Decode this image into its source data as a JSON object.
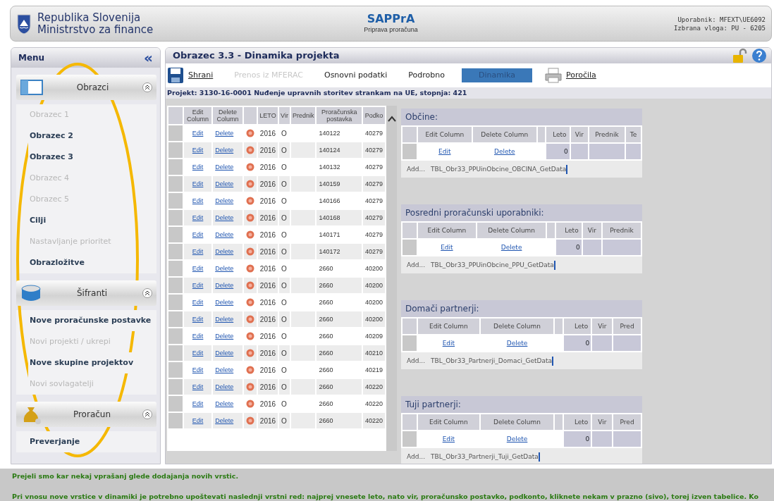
{
  "header": {
    "org_line1": "Republika Slovenija",
    "org_line2": "Ministrstvo za finance",
    "app_title": "SAPPrA",
    "app_subtitle": "Priprava proračuna",
    "user": "Uporabnik: MFEXT\\UE6092",
    "role": "Izbrana vloga: PU - 6205"
  },
  "menu": {
    "title": "Menu",
    "collapse_glyph": "«",
    "sections": [
      {
        "title": "Obrazci",
        "expanded": true,
        "items": [
          {
            "label": "Obrazec 1",
            "disabled": true
          },
          {
            "label": "Obrazec 2",
            "disabled": false
          },
          {
            "label": "Obrazec 3",
            "disabled": false
          },
          {
            "label": "Obrazec 4",
            "disabled": true
          },
          {
            "label": "Obrazec 5",
            "disabled": true
          },
          {
            "label": "Cilji",
            "disabled": false
          },
          {
            "label": "Nastavljanje prioritet",
            "disabled": true
          },
          {
            "label": "Obrazložitve",
            "disabled": false
          }
        ]
      },
      {
        "title": "Šifranti",
        "expanded": true,
        "items": [
          {
            "label": "Nove proračunske postavke",
            "disabled": false
          },
          {
            "label": "Novi projekti / ukrepi",
            "disabled": true
          },
          {
            "label": "Nove skupine projektov",
            "disabled": false
          },
          {
            "label": "Novi sovlagatelji",
            "disabled": true
          }
        ]
      },
      {
        "title": "Proračun",
        "expanded": true,
        "items": [
          {
            "label": "Preverjanje",
            "disabled": false
          }
        ]
      }
    ]
  },
  "page": {
    "title": "Obrazec 3.3 - Dinamika projekta",
    "toolbar": [
      {
        "kind": "save",
        "label": "Shrani",
        "disabled": false,
        "selected": false
      },
      {
        "kind": "link",
        "label": "Prenos iz MFERAC",
        "disabled": true,
        "selected": false
      },
      {
        "kind": "link",
        "label": "Osnovni podatki",
        "disabled": false,
        "selected": false
      },
      {
        "kind": "link",
        "label": "Podrobno",
        "disabled": false,
        "selected": false
      },
      {
        "kind": "link",
        "label": "Dinamika",
        "disabled": false,
        "selected": true
      },
      {
        "kind": "report",
        "label": "Poročila",
        "disabled": false,
        "selected": false
      }
    ],
    "project": "Projekt: 3130-16-0001 Nuđenje upravnih storitev strankam na UE, stopnja: 421",
    "table": {
      "columns": [
        "Edit Column",
        "Delete Column",
        "LETO",
        "Vir",
        "Prednik",
        "Proračunska postavka",
        "Podko"
      ],
      "rows": [
        {
          "edit": "Edit",
          "delete": "Delete",
          "leto": "2016",
          "vir": "O",
          "postavka": "140122",
          "podkonto": "40279"
        },
        {
          "edit": "Edit",
          "delete": "Delete",
          "leto": "2016",
          "vir": "O",
          "postavka": "140124",
          "podkonto": "40279"
        },
        {
          "edit": "Edit",
          "delete": "Delete",
          "leto": "2016",
          "vir": "O",
          "postavka": "140132",
          "podkonto": "40279"
        },
        {
          "edit": "Edit",
          "delete": "Delete",
          "leto": "2016",
          "vir": "O",
          "postavka": "140159",
          "podkonto": "40279"
        },
        {
          "edit": "Edit",
          "delete": "Delete",
          "leto": "2016",
          "vir": "O",
          "postavka": "140166",
          "podkonto": "40279"
        },
        {
          "edit": "Edit",
          "delete": "Delete",
          "leto": "2016",
          "vir": "O",
          "postavka": "140168",
          "podkonto": "40279"
        },
        {
          "edit": "Edit",
          "delete": "Delete",
          "leto": "2016",
          "vir": "O",
          "postavka": "140171",
          "podkonto": "40279"
        },
        {
          "edit": "Edit",
          "delete": "Delete",
          "leto": "2016",
          "vir": "O",
          "postavka": "140172",
          "podkonto": "40279"
        },
        {
          "edit": "Edit",
          "delete": "Delete",
          "leto": "2016",
          "vir": "O",
          "postavka": "2660",
          "podkonto": "40200"
        },
        {
          "edit": "Edit",
          "delete": "Delete",
          "leto": "2016",
          "vir": "O",
          "postavka": "2660",
          "podkonto": "40200"
        },
        {
          "edit": "Edit",
          "delete": "Delete",
          "leto": "2016",
          "vir": "O",
          "postavka": "2660",
          "podkonto": "40200"
        },
        {
          "edit": "Edit",
          "delete": "Delete",
          "leto": "2016",
          "vir": "O",
          "postavka": "2660",
          "podkonto": "40200"
        },
        {
          "edit": "Edit",
          "delete": "Delete",
          "leto": "2016",
          "vir": "O",
          "postavka": "2660",
          "podkonto": "40209"
        },
        {
          "edit": "Edit",
          "delete": "Delete",
          "leto": "2016",
          "vir": "O",
          "postavka": "2660",
          "podkonto": "40210"
        },
        {
          "edit": "Edit",
          "delete": "Delete",
          "leto": "2016",
          "vir": "O",
          "postavka": "2660",
          "podkonto": "40219"
        },
        {
          "edit": "Edit",
          "delete": "Delete",
          "leto": "2016",
          "vir": "O",
          "postavka": "2660",
          "podkonto": "40220"
        },
        {
          "edit": "Edit",
          "delete": "Delete",
          "leto": "2016",
          "vir": "O",
          "postavka": "2660",
          "podkonto": "40220"
        },
        {
          "edit": "Edit",
          "delete": "Delete",
          "leto": "2016",
          "vir": "O",
          "postavka": "2660",
          "podkonto": "40220"
        }
      ]
    },
    "panels": [
      {
        "title": "Občine:",
        "columns": [
          "Edit Column",
          "Delete Column",
          "Leto",
          "Vir",
          "Prednik",
          "Te"
        ],
        "row": {
          "edit": "Edit",
          "delete": "Delete",
          "leto": "0"
        },
        "add_label": "Add...",
        "add_link": "TBL_Obr33_PPUinObcine_OBCINA_GetData"
      },
      {
        "title": "Posredni proračunski uporabniki:",
        "columns": [
          "Edit Column",
          "Delete Column",
          "Leto",
          "Vir",
          "Prednik"
        ],
        "row": {
          "edit": "Edit",
          "delete": "Delete",
          "leto": "0"
        },
        "add_label": "Add...",
        "add_link": "TBL_Obr33_PPUinObcine_PPU_GetData"
      },
      {
        "title": "Domači partnerji:",
        "columns": [
          "Edit Column",
          "Delete Column",
          "Leto",
          "Vir",
          "Pred"
        ],
        "row": {
          "edit": "Edit",
          "delete": "Delete",
          "leto": "0"
        },
        "add_label": "Add...",
        "add_link": "TBL_Obr33_Partnerji_Domaci_GetData"
      },
      {
        "title": "Tuji partnerji:",
        "columns": [
          "Edit Column",
          "Delete Column",
          "Leto",
          "Vir",
          "Pred"
        ],
        "row": {
          "edit": "Edit",
          "delete": "Delete",
          "leto": "0"
        },
        "add_label": "Add...",
        "add_link": "TBL_Obr33_Partnerji_Tuji_GetData"
      }
    ]
  },
  "notice": [
    "Prejeli smo kar nekaj vprašanj glede dodajanja novih vrstic.",
    "Pri vnosu nove vrstice v dinamiki je potrebno upoštevati naslednji vrstni red: najprej vnesete leto, nato vir, proračunsko postavko, podkonto, kliknete nekam v prazno (sivo), torej izven tabelice. Ko"
  ],
  "highlight": {
    "kind": "ellipse"
  }
}
